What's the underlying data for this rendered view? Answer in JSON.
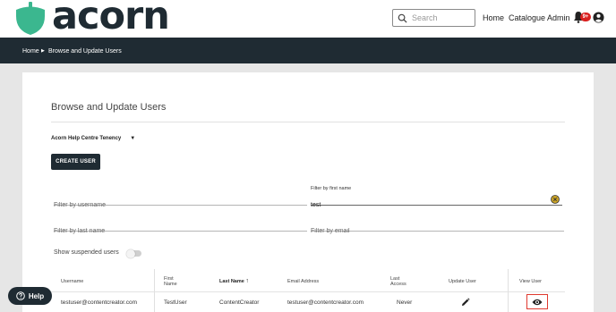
{
  "header": {
    "brand": "acorn",
    "search_placeholder": "Search",
    "nav": {
      "home": "Home",
      "catalogue": "Catalogue",
      "admin": "Admin"
    },
    "notification_badge": "9+",
    "accent_color": "#3bb78f",
    "dark_color": "#1f2b33"
  },
  "breadcrumb": {
    "home": "Home",
    "separator": "▶",
    "current": "Browse and Update Users"
  },
  "main": {
    "title": "Browse and Update Users",
    "tenancy": "Acorn Help Centre Tenency",
    "create_button": "CREATE USER",
    "filters": {
      "username_placeholder": "Filter by username",
      "first_name_label": "Filter by first name",
      "first_name_value": "test",
      "last_name_placeholder": "Filter by last name",
      "email_placeholder": "Filter by email"
    },
    "suspended_label": "Show suspended users",
    "suspended_on": false
  },
  "table": {
    "headers": {
      "username": "Username",
      "first_name": "First Name",
      "last_name": "Last Name",
      "email": "Email Address",
      "last_access": "Last Access",
      "update_user": "Update User",
      "view_user": "View User"
    },
    "rows": [
      {
        "username": "testuser@contentcreator.com",
        "first_name": "TestUser",
        "last_name": "ContentCreator",
        "email": "testuser@contentcreator.com",
        "last_access": "Never"
      }
    ]
  },
  "help": {
    "label": "Help"
  }
}
